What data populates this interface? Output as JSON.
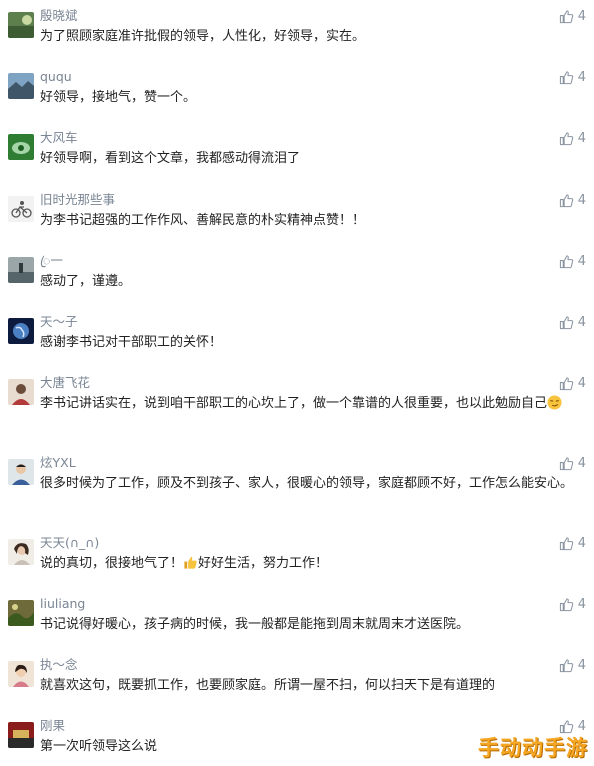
{
  "comments": [
    {
      "name": "殷晓斌",
      "text": "为了照顾家庭准许批假的领导，人性化，好领导，实在。",
      "likes": "4"
    },
    {
      "name": "ququ",
      "text": "好领导，接地气，赞一个。",
      "likes": "4"
    },
    {
      "name": "大风车",
      "text": "好领导啊，看到这个文章，我都感动得流泪了",
      "likes": "4"
    },
    {
      "name": "旧时光那些事",
      "text": "为李书记超强的工作作风、善解民意的朴实精神点赞！！",
      "likes": "4"
    },
    {
      "name": "ꦿ一",
      "text": "感动了，谨遵。",
      "likes": "4"
    },
    {
      "name": "天～子",
      "text": "感谢李书记对干部职工的关怀！",
      "likes": "4"
    },
    {
      "name": "大唐飞花",
      "text": "李书记讲话实在，说到咱干部职工的心坎上了，做一个靠谱的人很重要，也以此勉励自己",
      "likes": "4"
    },
    {
      "name": "炫YXL",
      "text": "很多时候为了工作，顾及不到孩子、家人，很暖心的领导，家庭都顾不好，工作怎么能安心。",
      "likes": "4"
    },
    {
      "name": "天天(∩_∩)",
      "text_a": "说的真切，很接地气了！",
      "text_b": "好好生活，努力工作！",
      "likes": "4"
    },
    {
      "name": "liuliang",
      "text": "书记说得好暖心，孩子病的时候，我一般都是能拖到周末就周末才送医院。",
      "likes": "4"
    },
    {
      "name": "执～念",
      "text": "就喜欢这句，既要抓工作，也要顾家庭。所谓一屋不扫，何以扫天下是有道理的",
      "likes": "4"
    },
    {
      "name": "刚果",
      "text": "第一次听领导这么说",
      "likes": "4"
    }
  ],
  "watermark": "手动动手游",
  "icons": {
    "like": "thumbs-up-icon"
  }
}
